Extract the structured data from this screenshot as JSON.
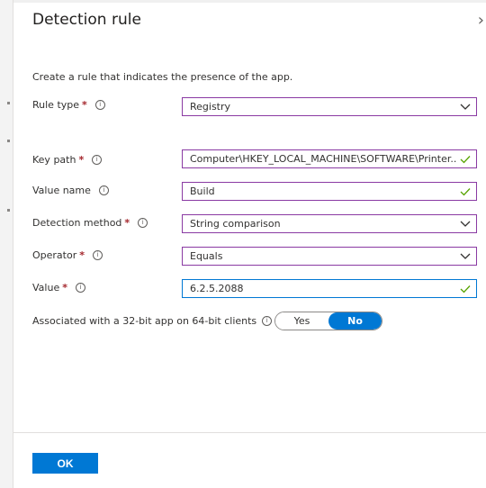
{
  "panel": {
    "title": "Detection rule",
    "close_icon": "chevron-right-icon",
    "description": "Create a rule that indicates the presence of the app."
  },
  "fields": {
    "rule_type": {
      "label": "Rule type",
      "required_mark": "*",
      "value": "Registry"
    },
    "key_path": {
      "label": "Key path",
      "required_mark": "*",
      "value": "Computer\\HKEY_LOCAL_MACHINE\\SOFTWARE\\Printer..."
    },
    "value_name": {
      "label": "Value name",
      "value": "Build"
    },
    "detection_method": {
      "label": "Detection method",
      "required_mark": "*",
      "value": "String comparison"
    },
    "operator": {
      "label": "Operator",
      "required_mark": "*",
      "value": "Equals"
    },
    "value": {
      "label": "Value",
      "required_mark": "*",
      "value": "6.2.5.2088"
    }
  },
  "associated": {
    "label": "Associated with a 32-bit app on 64-bit clients",
    "yes_label": "Yes",
    "no_label": "No",
    "selected": "No"
  },
  "footer": {
    "ok_label": "OK"
  },
  "colors": {
    "accent": "#0078d4",
    "field_border": "#8a3aa3",
    "required": "#a4262c"
  }
}
